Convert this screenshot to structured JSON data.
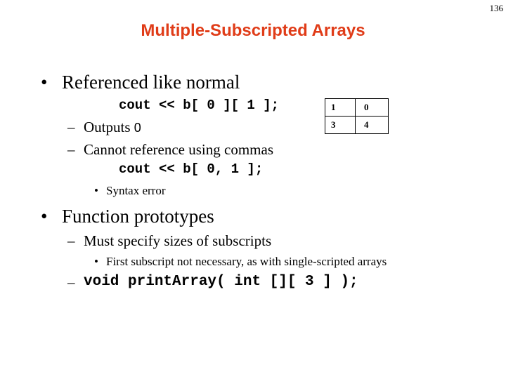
{
  "page_number": "136",
  "title": "Multiple-Subscripted Arrays",
  "bullets": {
    "referenced": {
      "text": "Referenced like normal",
      "code1": "cout << b[ 0 ][ 1 ];",
      "outputs_prefix": "Outputs ",
      "outputs_value": "0",
      "commas_text": "Cannot reference using commas",
      "code2": "cout << b[ 0, 1 ];",
      "syntax_error": "Syntax error"
    },
    "function_prototypes": {
      "text": "Function prototypes",
      "must_specify": "Must specify sizes of subscripts",
      "first_subscript": "First subscript not necessary, as with single-scripted arrays",
      "code": "void printArray( int [][ 3 ] );"
    }
  },
  "array_table": {
    "rows": [
      [
        "1",
        "0"
      ],
      [
        "3",
        "4"
      ]
    ]
  },
  "markers": {
    "bullet": "•",
    "dash": "–"
  }
}
